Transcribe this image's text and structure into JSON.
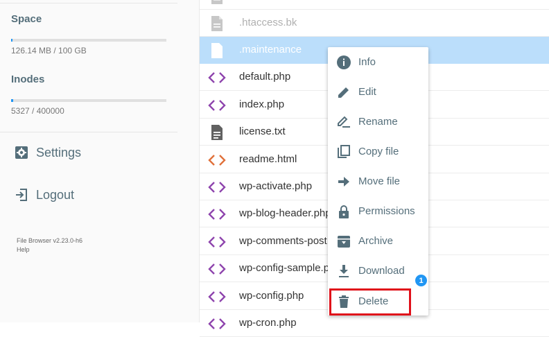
{
  "sidebar": {
    "space": {
      "title": "Space",
      "value": "126.14 MB / 100 GB",
      "used_fraction": 0.0012
    },
    "inodes": {
      "title": "Inodes",
      "value": "5327 / 400000",
      "used_fraction": 0.0133
    },
    "settings_label": "Settings",
    "logout_label": "Logout",
    "footer_version": "File Browser v2.23.0-h6",
    "footer_help": "Help"
  },
  "files": [
    {
      "name": "",
      "icon": "file-icon",
      "faded": true
    },
    {
      "name": ".htaccess.bk",
      "icon": "file-icon",
      "faded": true
    },
    {
      "name": ".maintenance",
      "icon": "file-icon",
      "selected": true
    },
    {
      "name": "default.php",
      "icon": "code-icon"
    },
    {
      "name": "index.php",
      "icon": "code-icon"
    },
    {
      "name": "license.txt",
      "icon": "text-file-icon"
    },
    {
      "name": "readme.html",
      "icon": "html-icon"
    },
    {
      "name": "wp-activate.php",
      "icon": "code-icon"
    },
    {
      "name": "wp-blog-header.php",
      "icon": "code-icon"
    },
    {
      "name": "wp-comments-post.php",
      "icon": "code-icon"
    },
    {
      "name": "wp-config-sample.php",
      "icon": "code-icon"
    },
    {
      "name": "wp-config.php",
      "icon": "code-icon"
    },
    {
      "name": "wp-cron.php",
      "icon": "code-icon"
    }
  ],
  "context_menu": {
    "items": [
      {
        "label": "Info",
        "icon": "info-icon"
      },
      {
        "label": "Edit",
        "icon": "pencil-icon"
      },
      {
        "label": "Rename",
        "icon": "rename-icon"
      },
      {
        "label": "Copy file",
        "icon": "copy-icon"
      },
      {
        "label": "Move file",
        "icon": "arrow-right-icon"
      },
      {
        "label": "Permissions",
        "icon": "lock-icon"
      },
      {
        "label": "Archive",
        "icon": "archive-icon"
      },
      {
        "label": "Download",
        "icon": "download-icon"
      },
      {
        "label": "Delete",
        "icon": "trash-icon"
      }
    ],
    "badge": "1"
  },
  "colors": {
    "accent": "#2196f3",
    "selected_row": "#bbdefb",
    "php_icon": "#8e44ad",
    "html_icon": "#e0703a",
    "highlight_border": "#e0101a",
    "menu_text": "#546e7a"
  }
}
